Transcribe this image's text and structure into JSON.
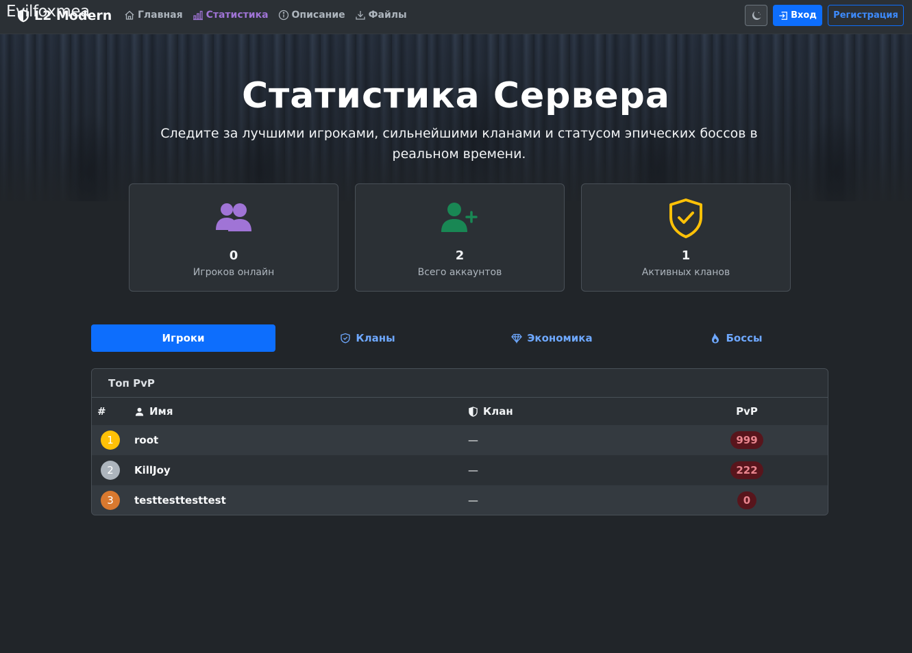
{
  "overlay_text": "Evilfoxmea",
  "nav": {
    "brand": "L2 Modern",
    "links": [
      {
        "label": "Главная",
        "icon": "house-icon"
      },
      {
        "label": "Статистика",
        "icon": "bar-chart-icon",
        "active": true
      },
      {
        "label": "Описание",
        "icon": "info-circle-icon"
      },
      {
        "label": "Файлы",
        "icon": "download-icon"
      }
    ],
    "theme_icon": "moon-icon",
    "login_label": "Вход",
    "register_label": "Регистрация"
  },
  "hero": {
    "title": "Статистика Сервера",
    "subtitle": "Следите за лучшими игроками, сильнейшими кланами и статусом эпических боссов в реальном времени."
  },
  "stats": [
    {
      "value": "0",
      "label": "Игроков онлайн",
      "icon": "people-icon",
      "color": "#a074d6"
    },
    {
      "value": "2",
      "label": "Всего аккаунтов",
      "icon": "person-plus-icon",
      "color": "#198754"
    },
    {
      "value": "1",
      "label": "Активных кланов",
      "icon": "shield-check-icon",
      "color": "#ffc107"
    }
  ],
  "tabs": [
    {
      "label": "Игроки",
      "active": true
    },
    {
      "label": "Кланы",
      "icon": "shield-icon"
    },
    {
      "label": "Экономика",
      "icon": "gem-icon"
    },
    {
      "label": "Боссы",
      "icon": "fire-icon"
    }
  ],
  "table": {
    "title": "Топ PvP",
    "columns": {
      "num": "#",
      "name": "Имя",
      "clan": "Клан",
      "pvp": "PvP"
    },
    "rows": [
      {
        "rank": "1",
        "name": "root",
        "clan": "—",
        "pvp": "999",
        "badge_color": "#ffc107"
      },
      {
        "rank": "2",
        "name": "KillJoy",
        "clan": "—",
        "pvp": "222",
        "badge_color": "#adb5bd"
      },
      {
        "rank": "3",
        "name": "testtesttesttest",
        "clan": "—",
        "pvp": "0",
        "badge_color": "#d9792f"
      }
    ]
  }
}
